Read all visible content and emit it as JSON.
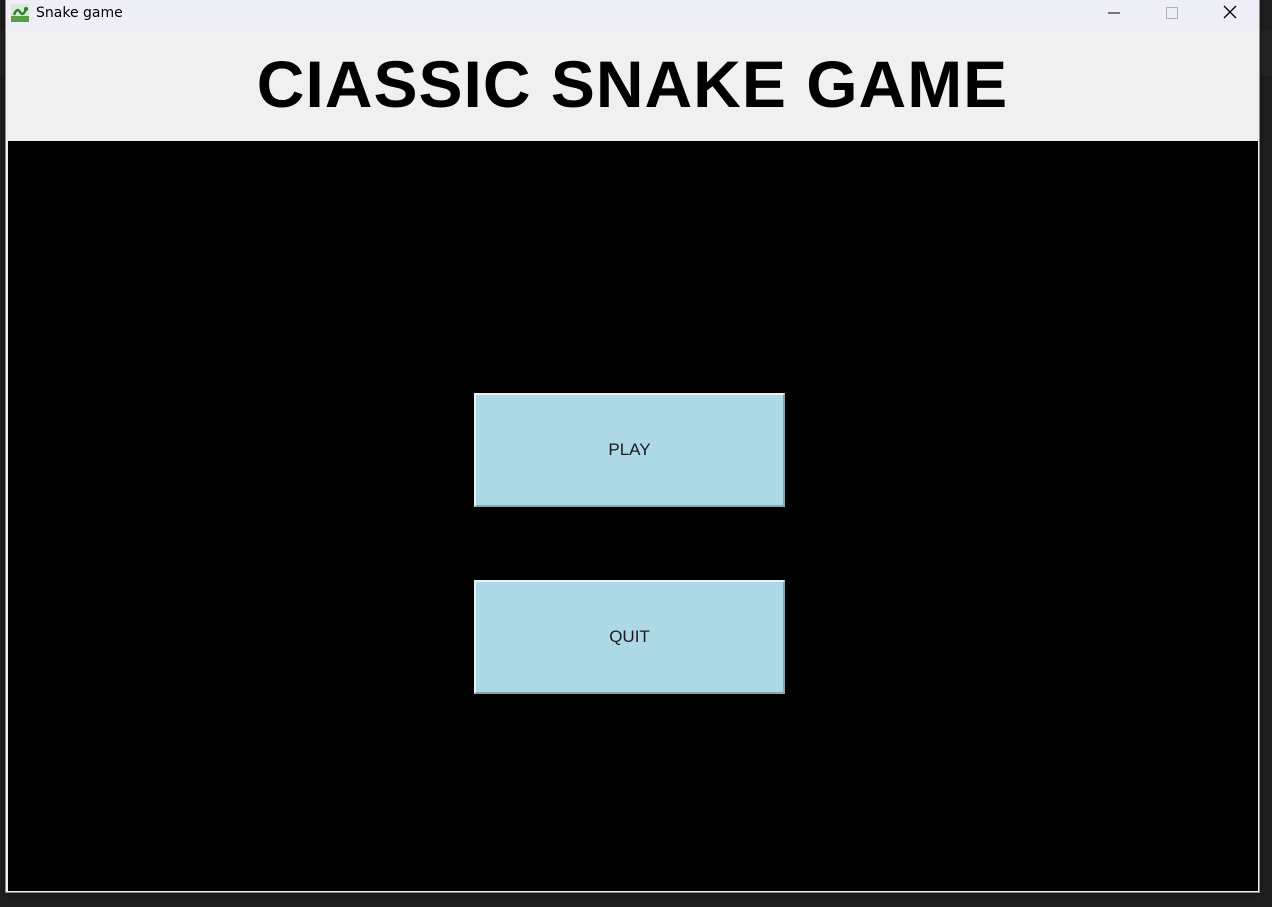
{
  "window": {
    "title": "Snake game",
    "controls": {
      "minimize_icon": "minimize-icon",
      "maximize_icon": "maximize-icon",
      "close_icon": "close-icon"
    }
  },
  "header": {
    "title": "CIASSIC SNAKE GAME"
  },
  "menu": {
    "play_label": "PLAY",
    "quit_label": "QUIT"
  },
  "colors": {
    "canvas_bg": "#000000",
    "button_bg": "#add8e6",
    "header_bg": "#f0f0f0"
  }
}
